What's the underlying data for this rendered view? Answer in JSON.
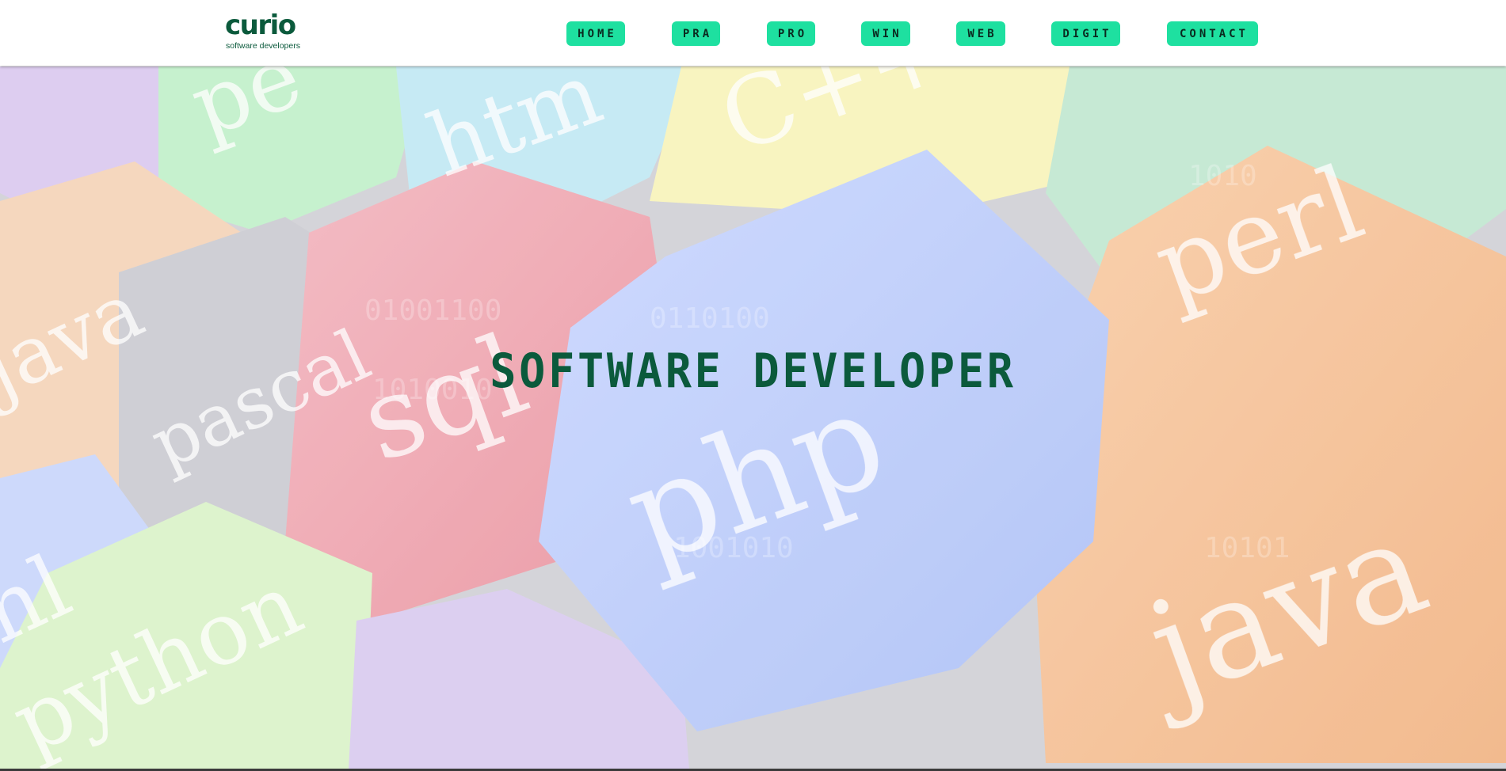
{
  "brand": {
    "name": "curio",
    "tagline": "software developers",
    "color": "#0b5a3c"
  },
  "nav": {
    "accent": "#1ee0a0",
    "items": [
      {
        "label": "HOME"
      },
      {
        "label": "PRA"
      },
      {
        "label": "PRO"
      },
      {
        "label": "WIN"
      },
      {
        "label": "WEB"
      },
      {
        "label": "DIGIT"
      },
      {
        "label": "CONTACT"
      }
    ]
  },
  "hero": {
    "title": "SOFTWARE DEVELOPER",
    "background_words": [
      "perl",
      "html",
      "C++",
      "perl",
      "java",
      "pascal",
      "sql",
      "php",
      "java",
      "html",
      "python"
    ]
  }
}
